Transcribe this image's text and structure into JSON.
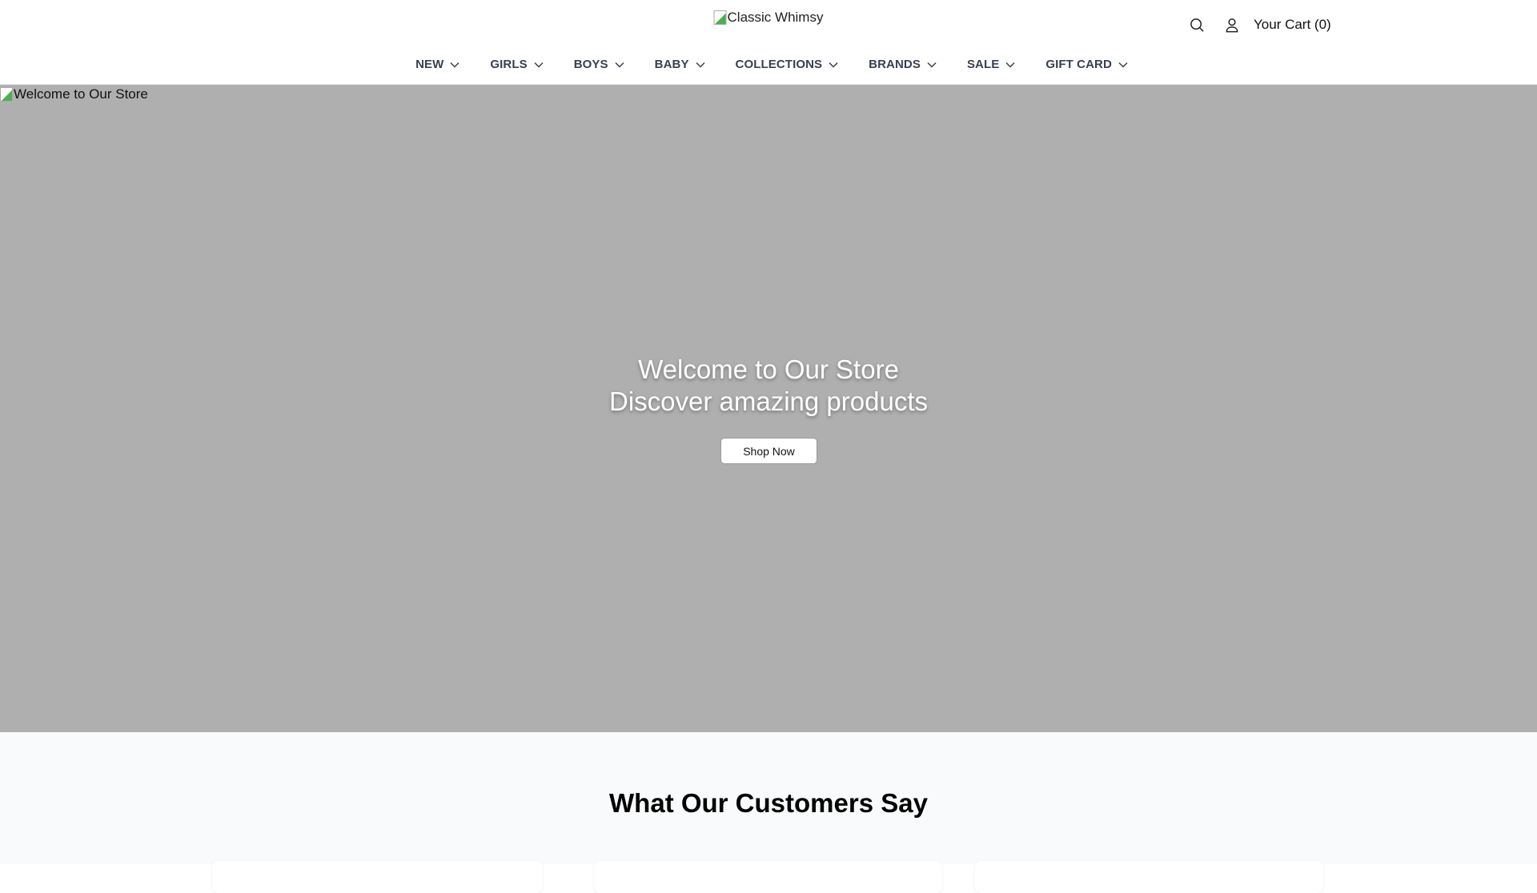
{
  "header": {
    "logo_alt": "Classic Whimsy",
    "cart_label": "Your Cart (0)",
    "icons": [
      "search-icon",
      "user-icon"
    ]
  },
  "nav": {
    "items": [
      {
        "label": "NEW"
      },
      {
        "label": "GIRLS"
      },
      {
        "label": "BOYS"
      },
      {
        "label": "BABY"
      },
      {
        "label": "COLLECTIONS"
      },
      {
        "label": "BRANDS"
      },
      {
        "label": "SALE"
      },
      {
        "label": "GIFT CARD"
      }
    ]
  },
  "hero": {
    "image_alt": "Welcome to Our Store",
    "title": "Welcome to Our Store",
    "subtitle": "Discover amazing products",
    "cta_label": "Shop Now",
    "background": "#afafaf"
  },
  "testimonials": {
    "heading": "What Our Customers Say"
  }
}
